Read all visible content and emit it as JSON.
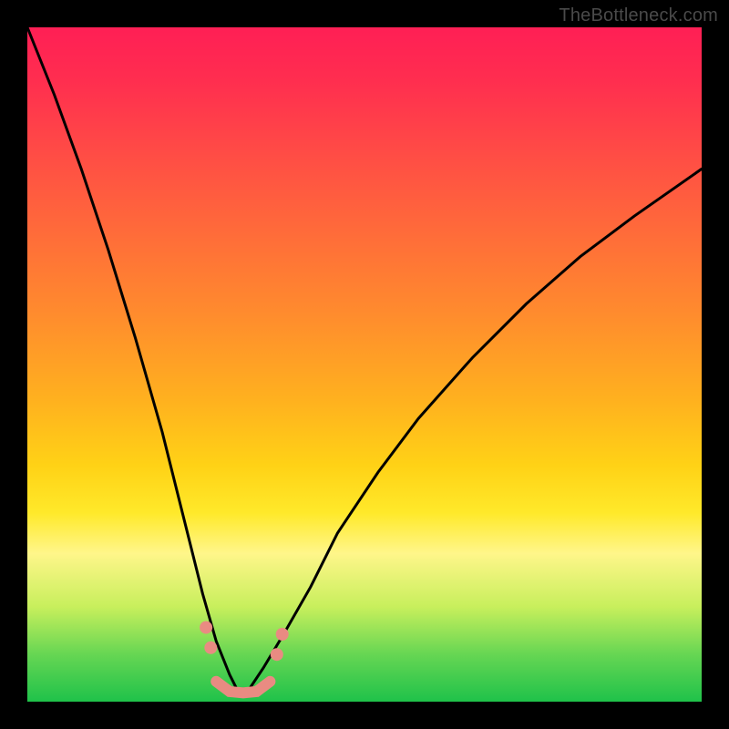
{
  "watermark": "TheBottleneck.com",
  "chart_data": {
    "type": "line",
    "title": "",
    "xlabel": "",
    "ylabel": "",
    "xlim": [
      0,
      100
    ],
    "ylim": [
      0,
      100
    ],
    "grid": false,
    "legend": false,
    "note": "Axes are unlabeled in the source image; values are normalized 0–100 from pixel positions. Two black curves descend from the upper region toward a flat basin near x≈30 then rise again toward the right. A short salmon highlight runs along the basin and a few salmon dots sit on the curve flanks just above it.",
    "series": [
      {
        "name": "left-curve",
        "x": [
          0,
          4,
          8,
          12,
          16,
          20,
          22,
          24,
          26,
          28,
          30,
          31
        ],
        "y": [
          100,
          90,
          79,
          67,
          54,
          40,
          32,
          24,
          16,
          9,
          4,
          2
        ]
      },
      {
        "name": "right-curve",
        "x": [
          33,
          35,
          38,
          42,
          46,
          52,
          58,
          66,
          74,
          82,
          90,
          100
        ],
        "y": [
          2,
          5,
          10,
          17,
          25,
          34,
          42,
          51,
          59,
          66,
          72,
          79
        ]
      },
      {
        "name": "basin-highlight",
        "color": "#e98b82",
        "x": [
          28,
          30,
          32,
          34,
          36
        ],
        "y": [
          3,
          1.5,
          1.3,
          1.5,
          3
        ]
      }
    ],
    "points": [
      {
        "name": "dot-left-upper",
        "x": 26.5,
        "y": 11,
        "color": "#e98b82"
      },
      {
        "name": "dot-left-lower",
        "x": 27.2,
        "y": 8,
        "color": "#e98b82"
      },
      {
        "name": "dot-right-lower",
        "x": 37.0,
        "y": 7,
        "color": "#e98b82"
      },
      {
        "name": "dot-right-upper",
        "x": 37.8,
        "y": 10,
        "color": "#e98b82"
      }
    ]
  }
}
